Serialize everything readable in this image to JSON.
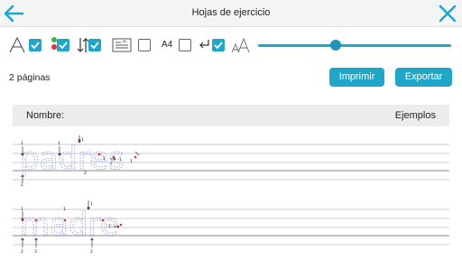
{
  "header": {
    "title": "Hojas de ejercicio",
    "back_icon": "arrow-left-icon",
    "close_icon": "close-icon"
  },
  "toolbar": {
    "font_icon": "font-outline-icon",
    "font_checked": true,
    "color_dots_icon": "color-dots-icon",
    "color_checked": true,
    "stroke_order_icon": "stroke-arrows-icon",
    "stroke_checked": true,
    "text_card_icon": "text-card-icon",
    "card_checked": false,
    "a4_label": "A4",
    "a4_checked": false,
    "return_icon": "return-arrow-icon",
    "return_checked": true,
    "size_icon": "font-size-icon",
    "size_slider_value": 0.4
  },
  "actions": {
    "page_count": "2 páginas",
    "print_label": "Imprimir",
    "export_label": "Exportar"
  },
  "sheet": {
    "name_label": "Nombre:",
    "examples_label": "Ejemplos",
    "rows": [
      {
        "word": "padres"
      },
      {
        "word": "madre"
      }
    ]
  },
  "colors": {
    "accent": "#1fa7c9",
    "title_bar": "#f4f4f4",
    "header_band": "#ececec",
    "trace": "#9aa6e8",
    "dots": "#e0303a"
  }
}
